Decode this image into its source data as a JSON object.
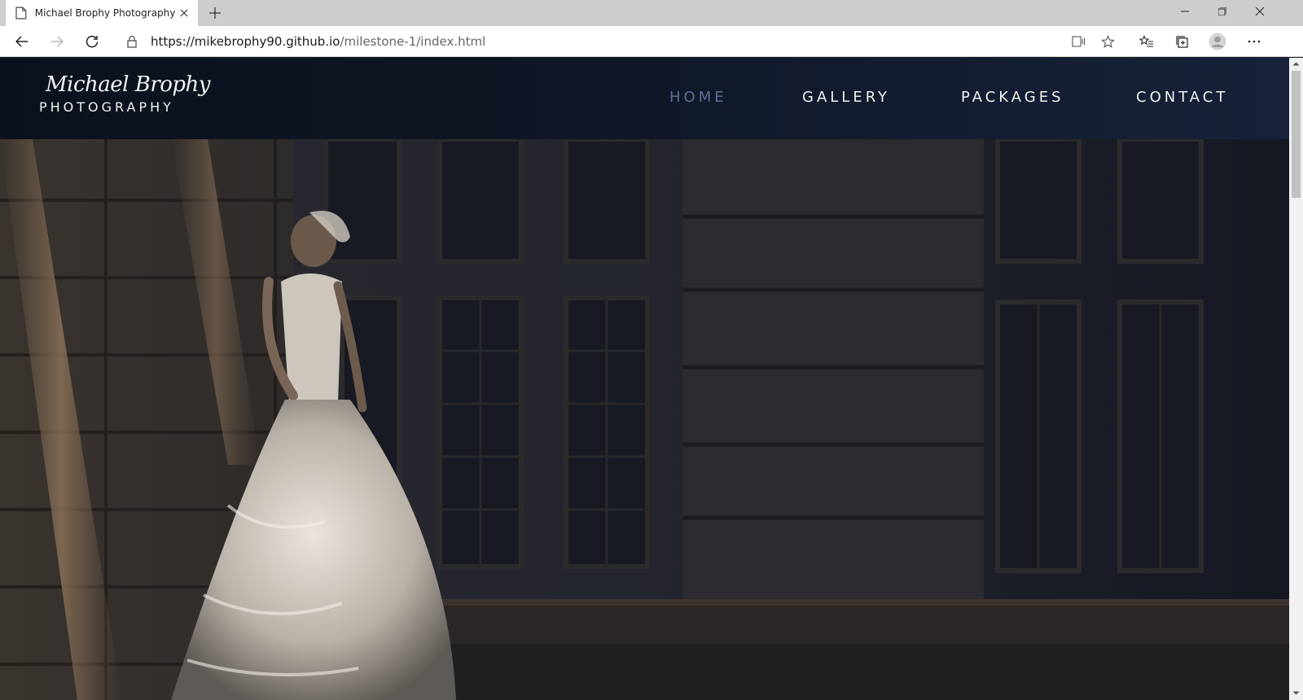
{
  "browser": {
    "tab_title": "Michael Brophy Photography",
    "url_host": "https://mikebrophy90.github.io",
    "url_path": "/milestone-1/index.html"
  },
  "site": {
    "logo_script": "Michael Brophy",
    "logo_word": "PHOTOGRAPHY",
    "nav": [
      {
        "label": "HOME",
        "active": true
      },
      {
        "label": "GALLERY",
        "active": false
      },
      {
        "label": "PACKAGES",
        "active": false
      },
      {
        "label": "CONTACT",
        "active": false
      }
    ],
    "colors": {
      "header_bg": "#0f1726",
      "nav_text": "#f1f1f1",
      "nav_active": "#5a6e97"
    }
  },
  "hero": {
    "image": "bride-in-white-gown-beside-stone-building"
  }
}
